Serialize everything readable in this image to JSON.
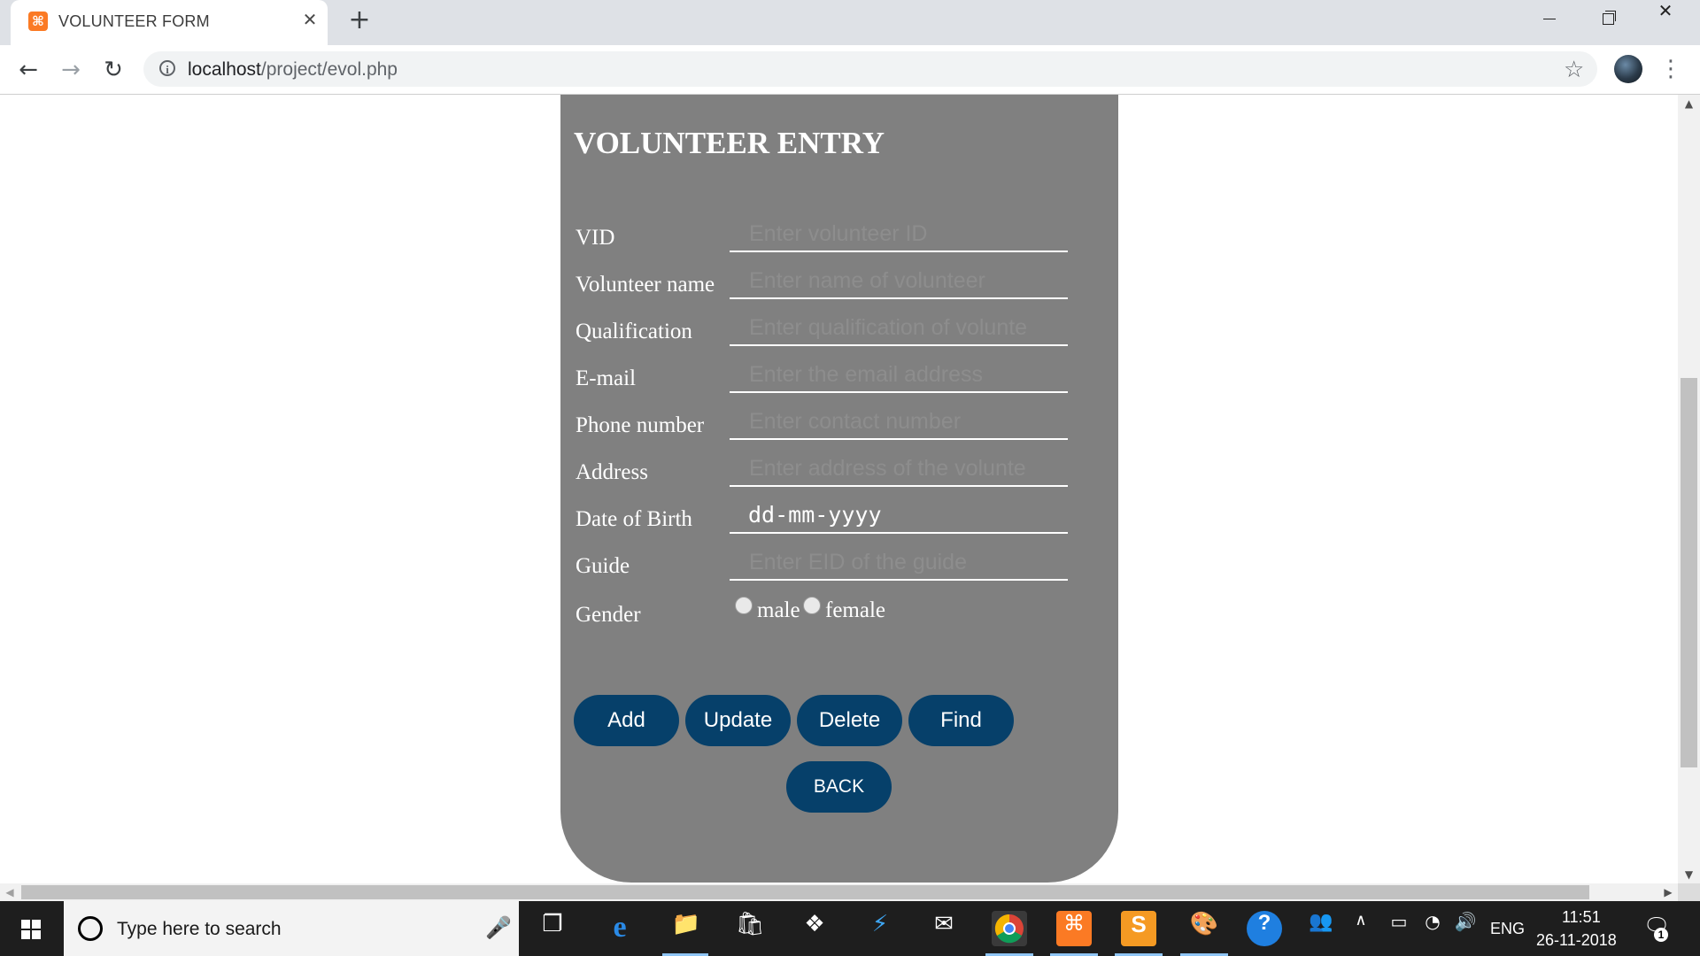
{
  "browser": {
    "tab_title": "VOLUNTEER FORM",
    "tab_favicon": "xampp-icon",
    "new_tab_symbol": "+",
    "url_host": "localhost",
    "url_path": "/project/evol.php"
  },
  "form": {
    "title": "VOLUNTEER ENTRY",
    "fields": [
      {
        "label": "VID",
        "placeholder": "Enter volunteer ID"
      },
      {
        "label": "Volunteer name",
        "placeholder": "Enter name of volunteer"
      },
      {
        "label": "Qualification",
        "placeholder": "Enter qualification of volunte"
      },
      {
        "label": "E-mail",
        "placeholder": "Enter the email address"
      },
      {
        "label": "Phone number",
        "placeholder": "Enter contact number"
      },
      {
        "label": "Address",
        "placeholder": "Enter address of the volunte"
      },
      {
        "label": "Date of Birth",
        "value": "dd-mm-yyyy"
      },
      {
        "label": "Guide",
        "placeholder": "Enter EID of the guide"
      }
    ],
    "gender": {
      "label": "Gender",
      "options": [
        "male",
        "female"
      ]
    },
    "buttons": {
      "add": "Add",
      "update": "Update",
      "delete": "Delete",
      "find": "Find",
      "back": "BACK"
    },
    "colors": {
      "panel": "#808080",
      "button": "#06406a"
    }
  },
  "taskbar": {
    "search_placeholder": "Type here to search",
    "language": "ENG",
    "time": "11:51",
    "date": "26-11-2018",
    "notification_count": "1"
  }
}
